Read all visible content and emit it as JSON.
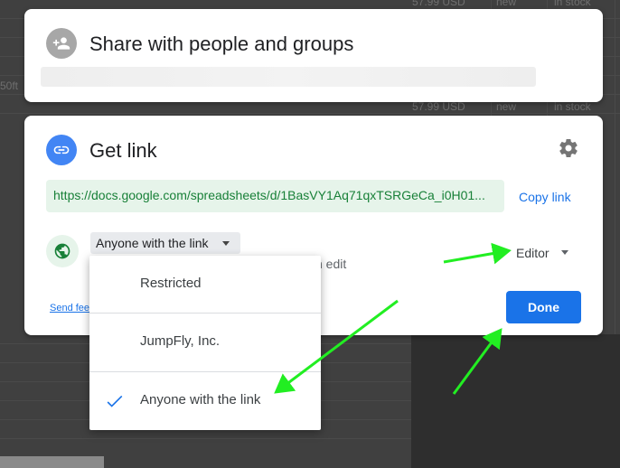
{
  "background": {
    "prices": [
      "57.99 USD",
      "57.99 USD"
    ],
    "conditions": [
      "new",
      "new"
    ],
    "stock": [
      "in stock",
      "in stock"
    ],
    "side_text": "50ft"
  },
  "share": {
    "title": "Share with people and groups",
    "icon": "person-add-icon"
  },
  "link": {
    "title": "Get link",
    "icon": "link-icon",
    "url": "https://docs.google.com/spreadsheets/d/1BasVY1Aq71qxTSRGeCa_i0H01...",
    "copy_label": "Copy link",
    "access_label": "Anyone with the link",
    "access_desc_fragment": "n edit",
    "role_label": "Editor",
    "feedback_label": "Send fee",
    "done_label": "Done"
  },
  "menu": {
    "items": [
      {
        "label": "Restricted",
        "selected": false
      },
      {
        "label": "JumpFly, Inc.",
        "selected": false
      },
      {
        "label": "Anyone with the link",
        "selected": true
      }
    ]
  },
  "colors": {
    "accent": "#1a73e8",
    "url_green": "#188038",
    "annotation_arrow": "#22ee22"
  }
}
